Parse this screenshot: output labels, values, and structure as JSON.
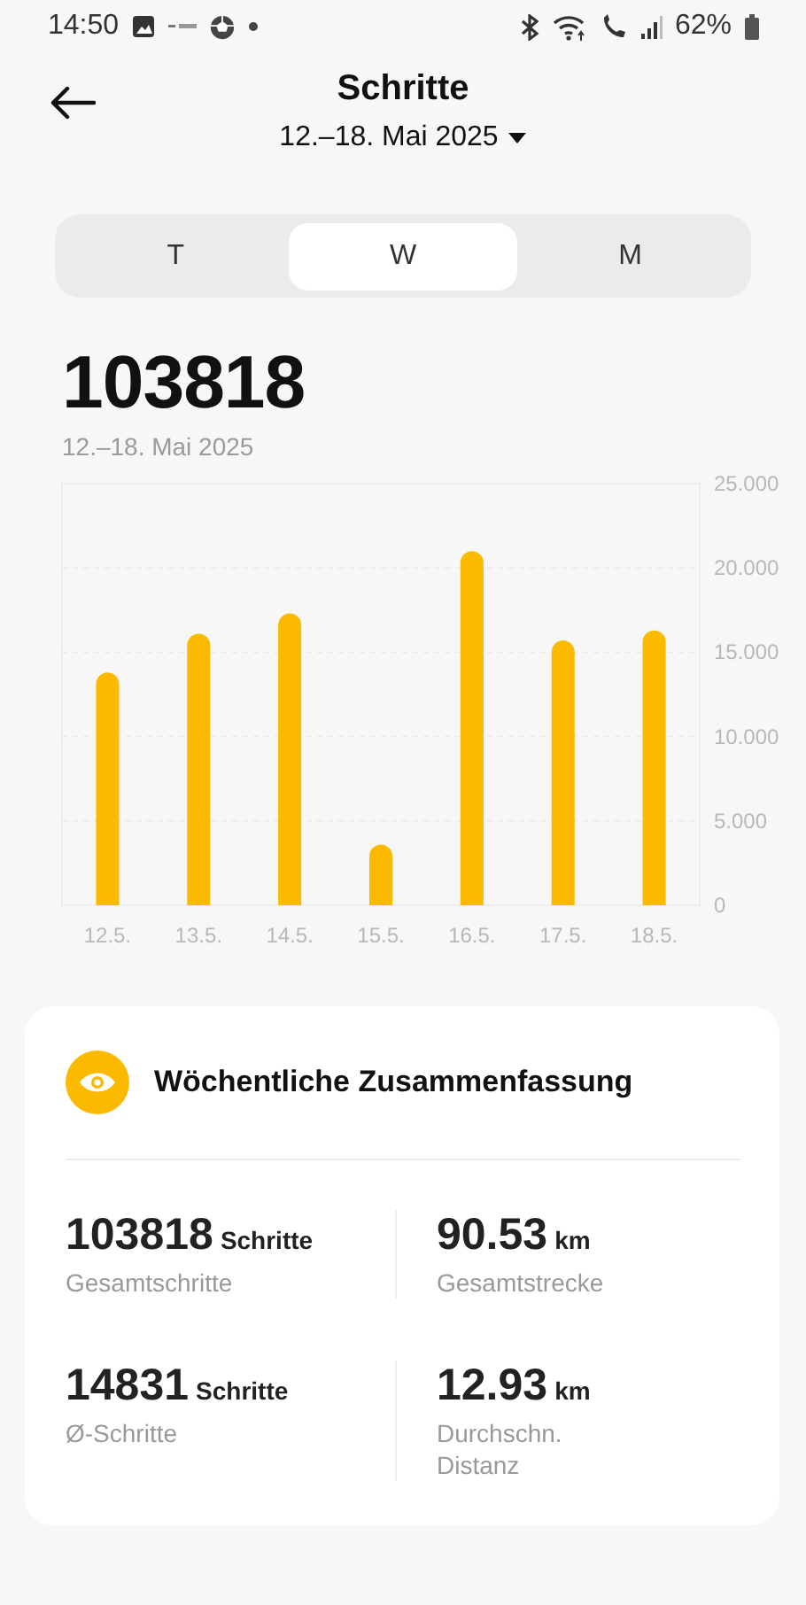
{
  "status_bar": {
    "time": "14:50",
    "battery": "62%"
  },
  "header": {
    "title": "Schritte",
    "date_range": "12.–18. Mai 2025"
  },
  "tabs": [
    {
      "label": "T",
      "selected": false
    },
    {
      "label": "W",
      "selected": true
    },
    {
      "label": "M",
      "selected": false
    }
  ],
  "total": {
    "value": "103818",
    "date": "12.–18. Mai 2025"
  },
  "chart_data": {
    "type": "bar",
    "categories": [
      "12.5.",
      "13.5.",
      "14.5.",
      "15.5.",
      "16.5.",
      "17.5.",
      "18.5."
    ],
    "series": [
      {
        "color": "#fbb900",
        "values": [
          13.8,
          16.1,
          17.3,
          3.6,
          21.0,
          15.7,
          16.3
        ]
      }
    ],
    "ylim": [
      0,
      25
    ],
    "grid": true,
    "yticks": [
      {
        "value": 0,
        "label": "0"
      },
      {
        "value": 5,
        "label": "5.000"
      },
      {
        "value": 10,
        "label": "10.000"
      },
      {
        "value": 15,
        "label": "15.000"
      },
      {
        "value": 20,
        "label": "20.000"
      },
      {
        "value": 25,
        "label": "25.000"
      }
    ]
  },
  "summary": {
    "title": "Wöchentliche Zusammenfassung",
    "stats": [
      {
        "value": "103818",
        "unit": "Schritte",
        "label": "Gesamtschritte"
      },
      {
        "value": "90.53",
        "unit": "km",
        "label": "Gesamtstrecke"
      },
      {
        "value": "14831",
        "unit": "Schritte",
        "label": "Ø-Schritte"
      },
      {
        "value": "12.93",
        "unit": "km",
        "label": "Durchschn. Distanz"
      }
    ]
  }
}
